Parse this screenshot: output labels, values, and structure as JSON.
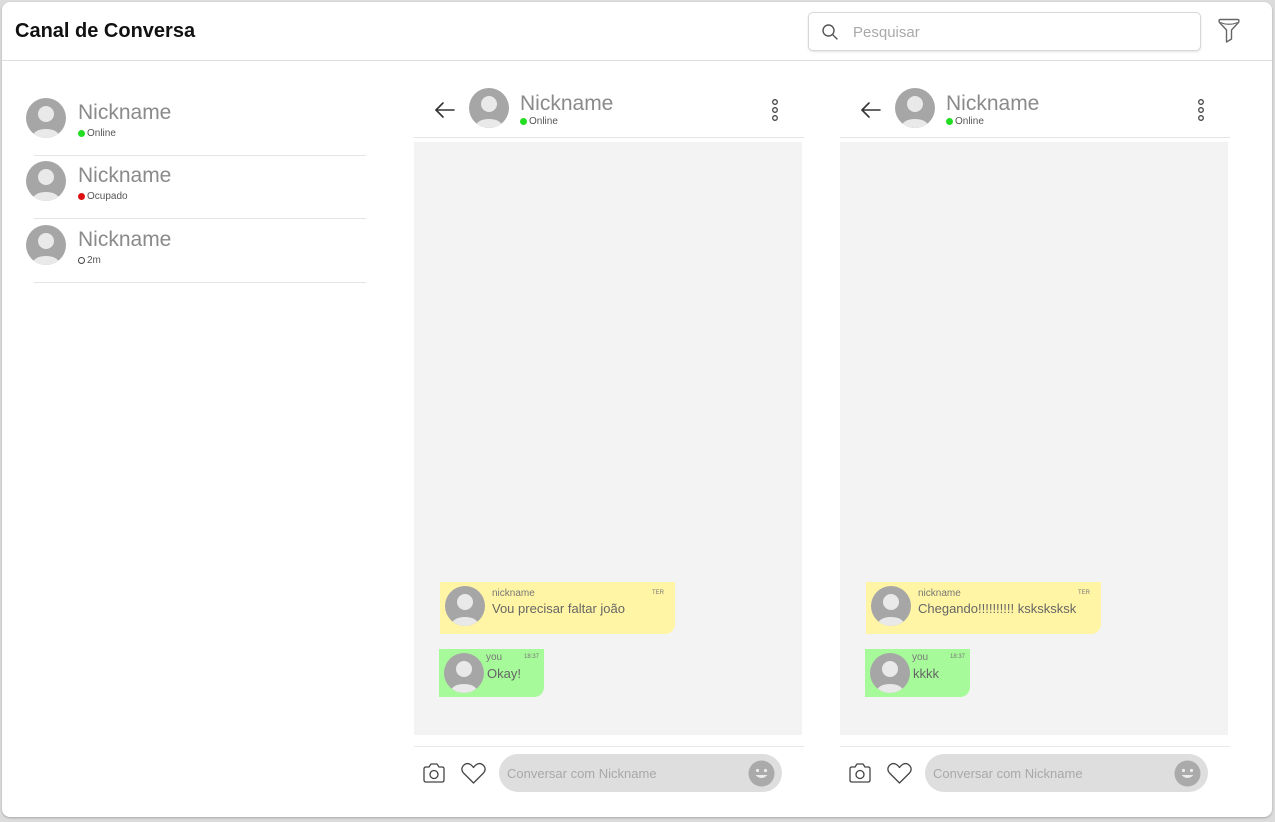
{
  "app": {
    "title": "Canal de Conversa"
  },
  "search": {
    "placeholder": "Pesquisar",
    "icon": "search-icon"
  },
  "filter": {
    "icon": "filter-icon"
  },
  "colors": {
    "online": "#22dd22",
    "busy": "#dd1111",
    "incoming_bubble": "#fff5a5",
    "outgoing_bubble": "#a6fa99",
    "chat_bg": "#f3f3f3"
  },
  "contacts": [
    {
      "name": "Nickname",
      "status": "Online",
      "status_type": "online"
    },
    {
      "name": "Nickname",
      "status": "Ocupado",
      "status_type": "busy"
    },
    {
      "name": "Nickname",
      "status": "2m",
      "status_type": "away"
    }
  ],
  "chats": [
    {
      "name": "Nickname",
      "status": "Online",
      "incoming": {
        "sender": "nickname",
        "text": "Vou precisar faltar joão",
        "time": "TER"
      },
      "outgoing": {
        "sender": "you",
        "text": "Okay!",
        "time": "18:37"
      },
      "input_placeholder": "Conversar com Nickname"
    },
    {
      "name": "Nickname",
      "status": "Online",
      "incoming": {
        "sender": "nickname",
        "text": "Chegando!!!!!!!!!! ksksksksk",
        "time": "TER"
      },
      "outgoing": {
        "sender": "you",
        "text": "kkkk",
        "time": "18:37"
      },
      "input_placeholder": "Conversar com Nickname"
    }
  ]
}
